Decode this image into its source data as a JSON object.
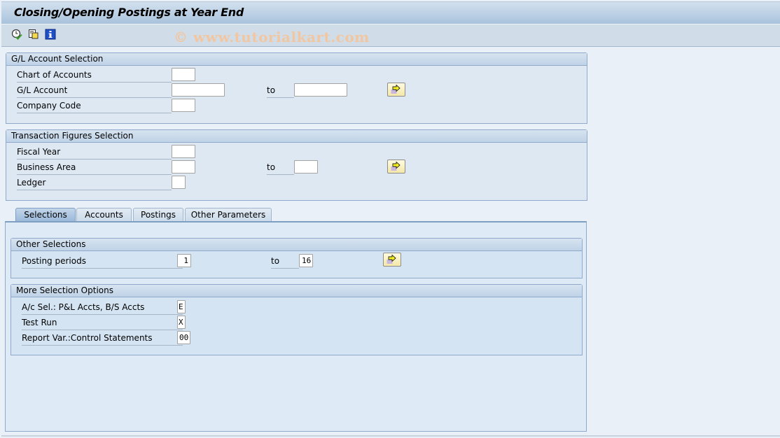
{
  "window": {
    "title": "Closing/Opening Postings at Year End",
    "watermark": "© www.tutorialkart.com"
  },
  "toolbar": {
    "icons": [
      {
        "name": "execute-icon",
        "tooltip": "Execute"
      },
      {
        "name": "get-variant-icon",
        "tooltip": "Get Variant"
      },
      {
        "name": "info-icon",
        "tooltip": "Program Documentation"
      }
    ]
  },
  "gl_account_selection": {
    "title": "G/L Account Selection",
    "fields": [
      {
        "label": "Chart of Accounts",
        "value": ""
      },
      {
        "label": "G/L Account",
        "value": "",
        "to_label": "to",
        "to_value": ""
      },
      {
        "label": "Company Code",
        "value": ""
      }
    ]
  },
  "transaction_figures_selection": {
    "title": "Transaction Figures Selection",
    "fields": [
      {
        "label": "Fiscal Year",
        "value": ""
      },
      {
        "label": "Business Area",
        "value": "",
        "to_label": "to",
        "to_value": ""
      },
      {
        "label": "Ledger",
        "value": ""
      }
    ]
  },
  "tabs": [
    {
      "label": "Selections",
      "active": true
    },
    {
      "label": "Accounts",
      "active": false
    },
    {
      "label": "Postings",
      "active": false
    },
    {
      "label": "Other Parameters",
      "active": false
    }
  ],
  "other_selections": {
    "title": "Other Selections",
    "posting_periods": {
      "label": "Posting periods",
      "from": "1",
      "to_label": "to",
      "to": "16"
    }
  },
  "more_selection_options": {
    "title": "More Selection Options",
    "fields": [
      {
        "label": "A/c Sel.: P&L Accts, B/S Accts",
        "value": "E"
      },
      {
        "label": "Test Run",
        "value": "X"
      },
      {
        "label": "Report Var.:Control Statements",
        "value": "00"
      }
    ]
  }
}
